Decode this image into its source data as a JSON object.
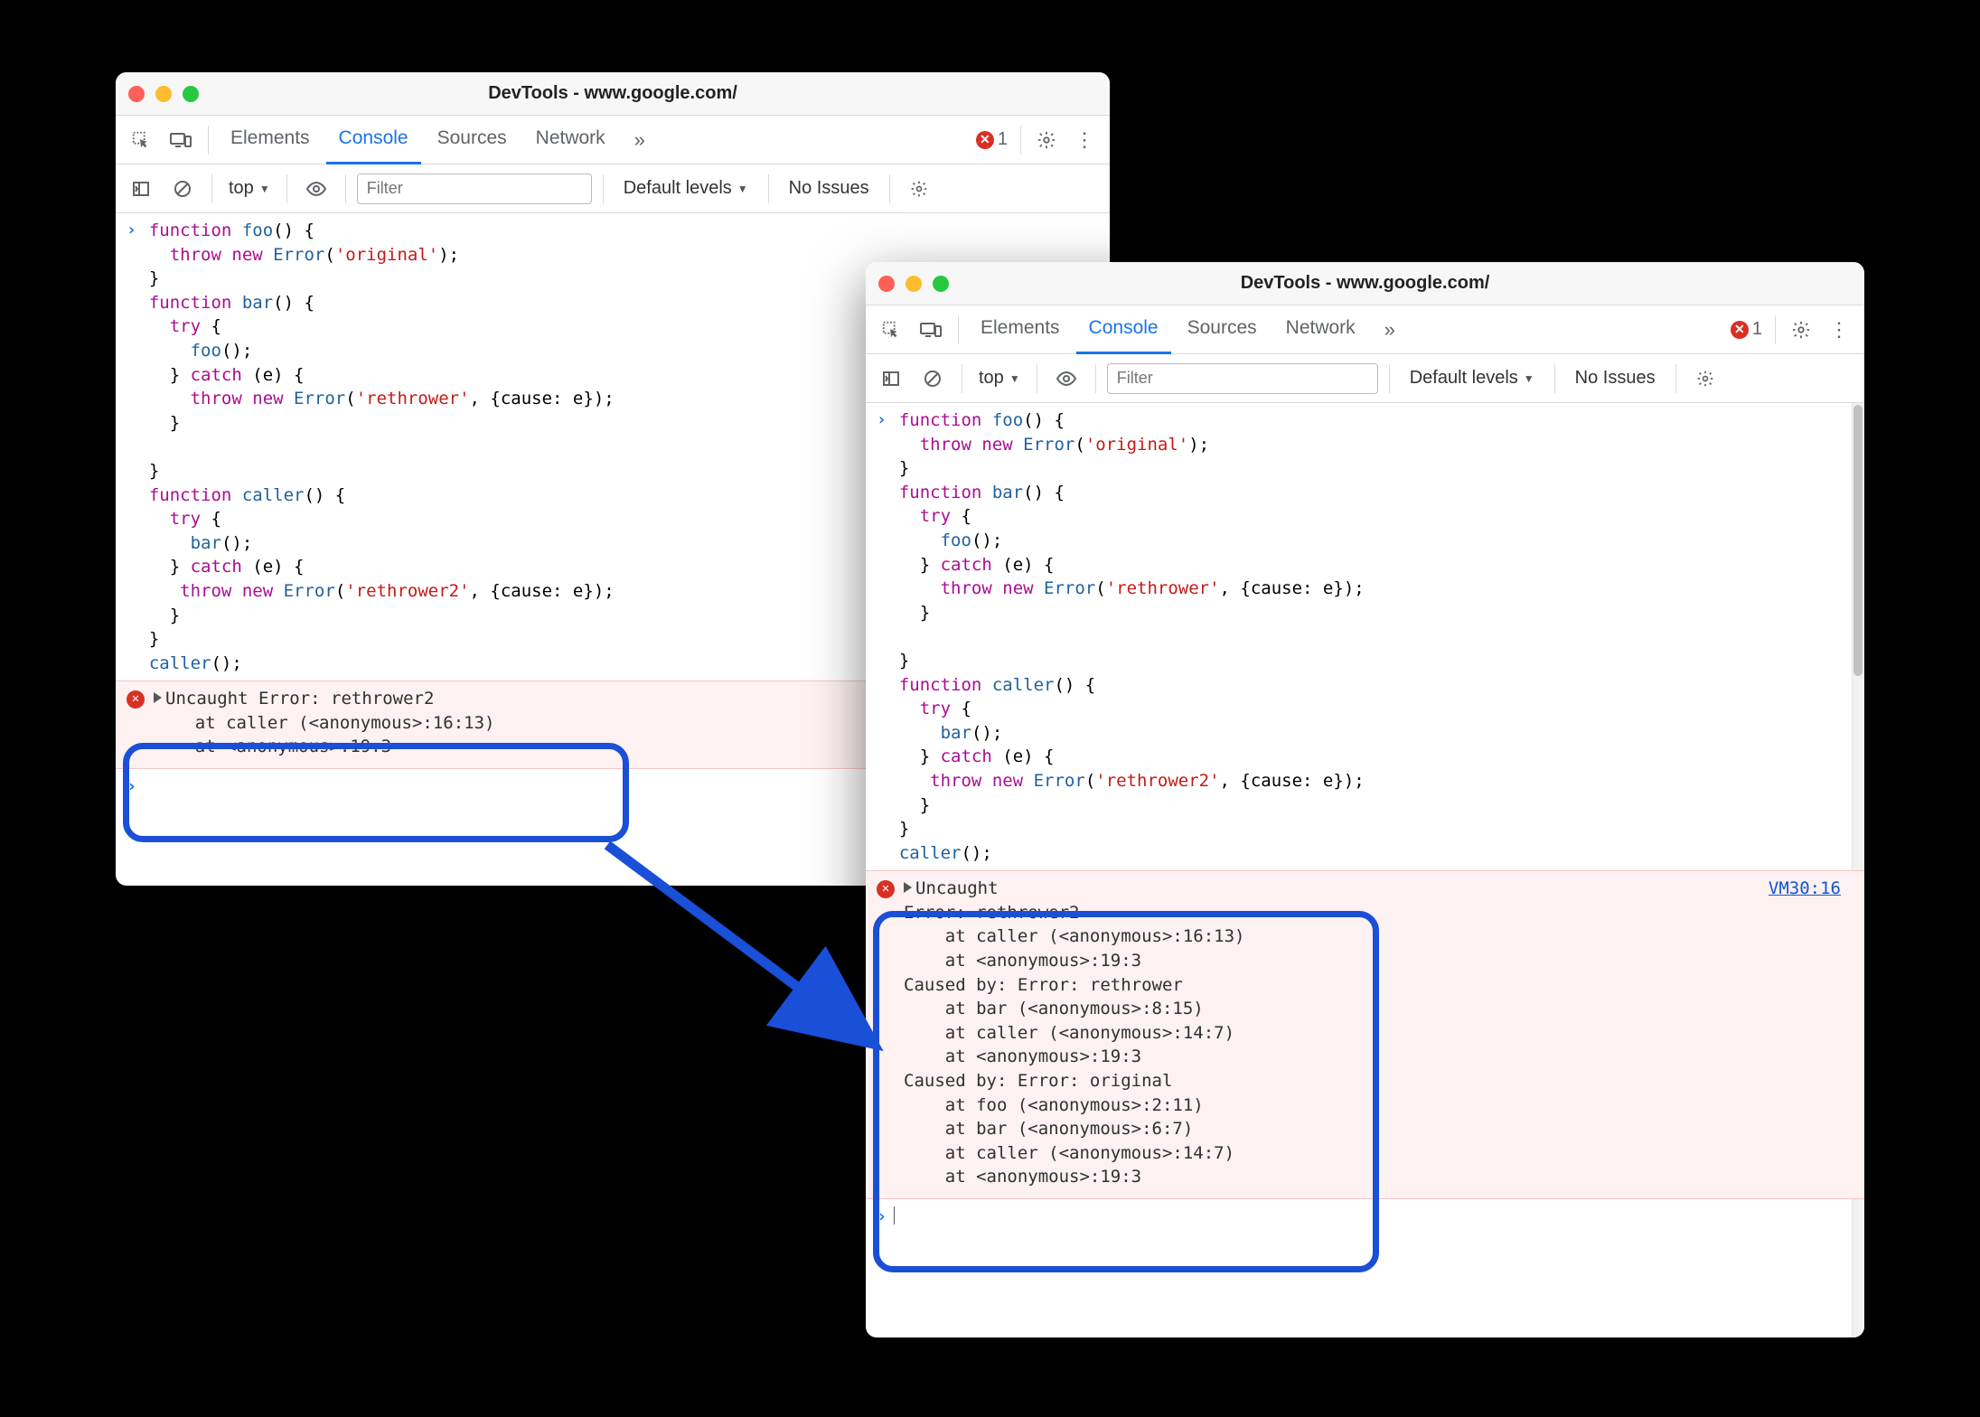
{
  "window1": {
    "title": "DevTools - www.google.com/",
    "tabs": [
      "Elements",
      "Console",
      "Sources",
      "Network"
    ],
    "active_tab": "Console",
    "error_count": "1",
    "context": "top",
    "filter_placeholder": "Filter",
    "levels_label": "Default levels",
    "issues_label": "No Issues",
    "code": "function foo() {\n  throw new Error('original');\n}\nfunction bar() {\n  try {\n    foo();\n  } catch (e) {\n    throw new Error('rethrower', {cause: e});\n  }\n\n}\nfunction caller() {\n  try {\n    bar();\n  } catch (e) {\n   throw new Error('rethrower2', {cause: e});\n  }\n}\ncaller();",
    "error_message": "Uncaught Error: rethrower2\n    at caller (<anonymous>:16:13)\n    at <anonymous>:19:3"
  },
  "window2": {
    "title": "DevTools - www.google.com/",
    "tabs": [
      "Elements",
      "Console",
      "Sources",
      "Network"
    ],
    "active_tab": "Console",
    "error_count": "1",
    "context": "top",
    "filter_placeholder": "Filter",
    "levels_label": "Default levels",
    "issues_label": "No Issues",
    "code": "function foo() {\n  throw new Error('original');\n}\nfunction bar() {\n  try {\n    foo();\n  } catch (e) {\n    throw new Error('rethrower', {cause: e});\n  }\n\n}\nfunction caller() {\n  try {\n    bar();\n  } catch (e) {\n   throw new Error('rethrower2', {cause: e});\n  }\n}\ncaller();",
    "error_message": "Uncaught \nError: rethrower2\n    at caller (<anonymous>:16:13)\n    at <anonymous>:19:3\nCaused by: Error: rethrower\n    at bar (<anonymous>:8:15)\n    at caller (<anonymous>:14:7)\n    at <anonymous>:19:3\nCaused by: Error: original\n    at foo (<anonymous>:2:11)\n    at bar (<anonymous>:6:7)\n    at caller (<anonymous>:14:7)\n    at <anonymous>:19:3",
    "source_link": "VM30:16"
  }
}
